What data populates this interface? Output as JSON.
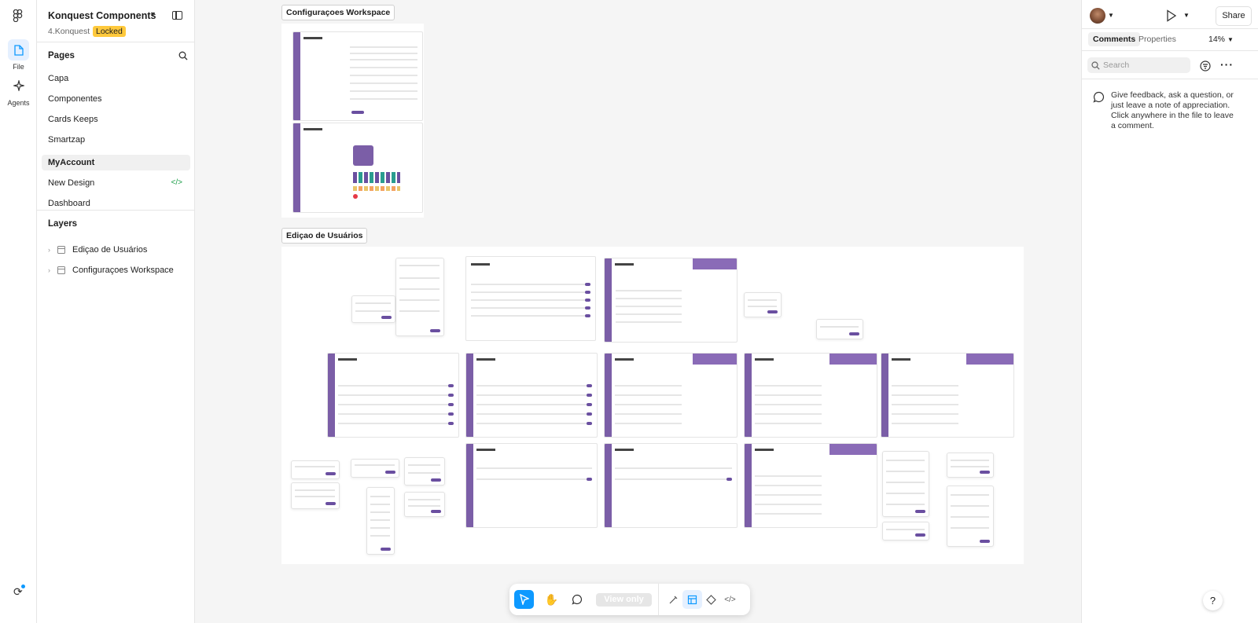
{
  "rail": {
    "file_label": "File",
    "agents_label": "Agents"
  },
  "project": {
    "title": "Konquest Components",
    "subtitle": "4.Konquest",
    "badge": "Locked"
  },
  "pages": {
    "title": "Pages",
    "items": [
      "Capa",
      "Componentes",
      "Cards Keeps",
      "Smartzap",
      "MyAccount",
      "New Design",
      "Dashboard"
    ],
    "selected": "MyAccount"
  },
  "layers": {
    "title": "Layers",
    "items": [
      "Ediçao de Usuários",
      "Configuraçoes Workspace"
    ]
  },
  "canvas": {
    "frame1_label": "Configuraçoes Workspace",
    "frame2_label": "Ediçao de Usuários",
    "mini_title": "Usuários"
  },
  "toolbar": {
    "view_only": "View only"
  },
  "right_panel": {
    "share_label": "Share",
    "tab_comments": "Comments",
    "tab_properties": "Properties",
    "zoom": "14%",
    "search_placeholder": "Search",
    "hint": "Give feedback, ask a question, or just leave a note of appreciation. Click anywhere in the file to leave a comment.",
    "help": "?"
  },
  "colors": {
    "accent": "#0d99ff",
    "badge": "#ffc93c",
    "brand_purple": "#7b5ea7"
  }
}
